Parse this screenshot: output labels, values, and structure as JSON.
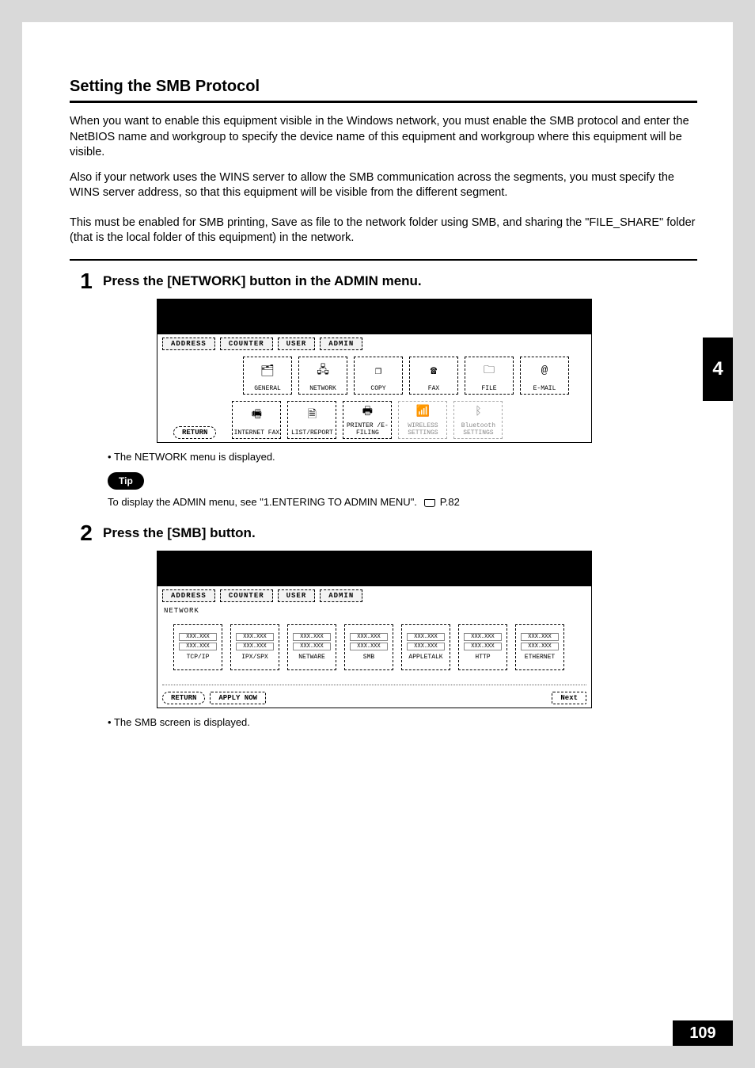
{
  "section_title": "Setting the SMB Protocol",
  "intro_p1": "When you want to enable this equipment visible in the Windows network, you must enable the SMB protocol and enter the NetBIOS name and workgroup to specify the device name of this equipment and workgroup where this equipment will be visible.",
  "intro_p2": "Also if your network uses the WINS server to allow the SMB communication across the segments, you must specify the WINS server address, so that this equipment will be visible from the different segment.",
  "intro_p3": "This must be enabled for SMB printing, Save as file to the network folder using SMB, and sharing the \"FILE_SHARE\" folder (that is the local folder of this equipment) in the network.",
  "step1": {
    "num": "1",
    "title": "Press the [NETWORK] button in the ADMIN menu.",
    "bullet": "The NETWORK menu is displayed."
  },
  "tip": {
    "label": "Tip",
    "text": "To display the ADMIN menu, see \"1.ENTERING TO ADMIN MENU\".",
    "page_ref": "P.82"
  },
  "step2": {
    "num": "2",
    "title": "Press the [SMB] button.",
    "bullet": "The SMB screen is displayed."
  },
  "mock": {
    "tabs": [
      "ADDRESS",
      "COUNTER",
      "USER",
      "ADMIN"
    ],
    "admin_row1": [
      "GENERAL",
      "NETWORK",
      "COPY",
      "FAX",
      "FILE",
      "E-MAIL"
    ],
    "admin_row2": [
      "INTERNET FAX",
      "LIST/REPORT",
      "PRINTER /E-FILING",
      "WIRELESS SETTINGS",
      "Bluetooth SETTINGS"
    ],
    "return": "RETURN",
    "network_label": "NETWORK",
    "net_buttons": [
      "TCP/IP",
      "IPX/SPX",
      "NETWARE",
      "SMB",
      "APPLETALK",
      "HTTP",
      "ETHERNET"
    ],
    "xxx": "XXX.XXX",
    "apply_now": "APPLY NOW",
    "next": "Next"
  },
  "side_tab": "4",
  "page_number": "109"
}
